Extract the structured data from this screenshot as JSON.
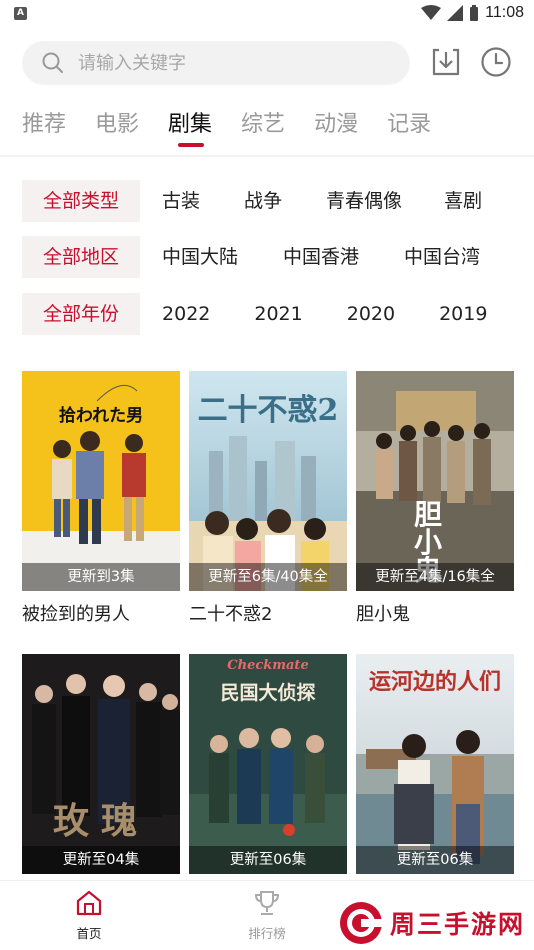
{
  "status_bar": {
    "time": "11:08",
    "left_badge": "A"
  },
  "search": {
    "placeholder": "请输入关键字"
  },
  "header_icons": [
    "download-icon",
    "history-clock-icon"
  ],
  "category_tabs": [
    {
      "label": "推荐",
      "active": false
    },
    {
      "label": "电影",
      "active": false
    },
    {
      "label": "剧集",
      "active": true
    },
    {
      "label": "综艺",
      "active": false
    },
    {
      "label": "动漫",
      "active": false
    },
    {
      "label": "记录",
      "active": false
    }
  ],
  "filters": {
    "type": {
      "selected": "全部类型",
      "options": [
        "古装",
        "战争",
        "青春偶像",
        "喜剧"
      ]
    },
    "region": {
      "selected": "全部地区",
      "options": [
        "中国大陆",
        "中国香港",
        "中国台湾"
      ]
    },
    "year": {
      "selected": "全部年份",
      "options": [
        "2022",
        "2021",
        "2020",
        "2019"
      ]
    }
  },
  "shows": [
    {
      "name": "被捡到的男人",
      "badge": "更新到3集",
      "poster_text": "拾われた男"
    },
    {
      "name": "二十不惑2",
      "badge": "更新至6集/40集全",
      "poster_text": "二十不惑2"
    },
    {
      "name": "胆小鬼",
      "badge": "更新至4集/16集全",
      "poster_text": "胆小鬼"
    },
    {
      "name": "",
      "badge": "更新至04集",
      "poster_text": "玫瑰"
    },
    {
      "name": "",
      "badge": "更新至06集",
      "poster_text": "民国大侦探"
    },
    {
      "name": "",
      "badge": "更新至06集",
      "poster_text": "运河边的人们"
    }
  ],
  "bottom_nav": [
    {
      "label": "首页",
      "active": true,
      "icon": "home-icon"
    },
    {
      "label": "排行榜",
      "active": false,
      "icon": "trophy-icon"
    }
  ],
  "watermark": {
    "text": "周三手游网"
  },
  "colors": {
    "accent": "#c8102e",
    "chip_bg": "#f5f1f1",
    "search_bg": "#f2f2f2"
  }
}
